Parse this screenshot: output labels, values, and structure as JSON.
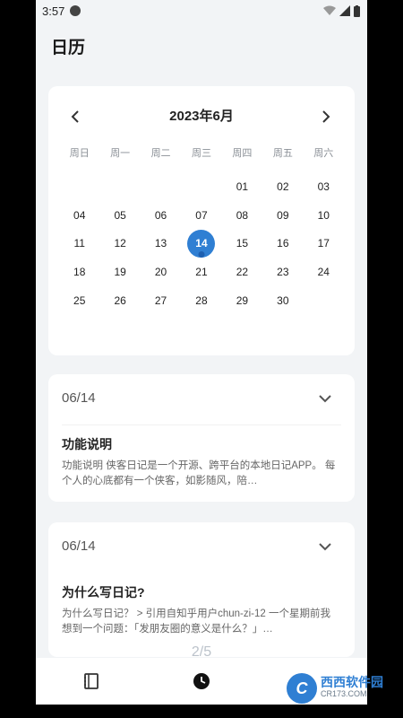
{
  "status_bar": {
    "time": "3:57"
  },
  "header": {
    "title": "日历"
  },
  "calendar": {
    "month_title": "2023年6月",
    "weekdays": [
      "周日",
      "周一",
      "周二",
      "周三",
      "周四",
      "周五",
      "周六"
    ],
    "leading_blanks": 4,
    "days": [
      "01",
      "02",
      "03",
      "04",
      "05",
      "06",
      "07",
      "08",
      "09",
      "10",
      "11",
      "12",
      "13",
      "14",
      "15",
      "16",
      "17",
      "18",
      "19",
      "20",
      "21",
      "22",
      "23",
      "24",
      "25",
      "26",
      "27",
      "28",
      "29",
      "30"
    ],
    "selected_day": "14"
  },
  "entries": [
    {
      "date": "06/14",
      "title": "功能说明",
      "body": "功能说明  侠客日记是一个开源、跨平台的本地日记APP。  每个人的心底都有一个侠客，如影随风，陪…"
    },
    {
      "date": "06/14",
      "title": "为什么写日记?",
      "body": "为什么写日记？  > 引用自知乎用户chun-zi-12  一个星期前我想到一个问题：「发朋友圈的意义是什么？」…"
    }
  ],
  "pager": {
    "text": "2/5"
  },
  "bottom_nav": {
    "tabs": [
      "diary-tab",
      "calendar-tab",
      "settings-tab"
    ]
  },
  "watermark": {
    "brand": "西西软件园",
    "site": "CR173.COM"
  }
}
